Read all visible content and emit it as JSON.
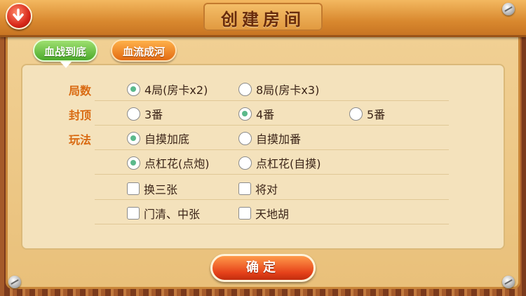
{
  "header": {
    "title": "创建房间"
  },
  "tabs": [
    {
      "label": "血战到底",
      "selected": true
    },
    {
      "label": "血流成河",
      "selected": false
    }
  ],
  "rules": {
    "rounds": {
      "label": "局数",
      "options": [
        {
          "label": "4局(房卡x2)",
          "selected": true
        },
        {
          "label": "8局(房卡x3)",
          "selected": false
        }
      ]
    },
    "cap": {
      "label": "封顶",
      "options": [
        {
          "label": "3番",
          "selected": false
        },
        {
          "label": "4番",
          "selected": true
        },
        {
          "label": "5番",
          "selected": false
        }
      ]
    },
    "play": {
      "label": "玩法",
      "bonus": [
        {
          "label": "自摸加底",
          "selected": true
        },
        {
          "label": "自摸加番",
          "selected": false
        }
      ],
      "kong": [
        {
          "label": "点杠花(点炮)",
          "selected": true
        },
        {
          "label": "点杠花(自摸)",
          "selected": false
        }
      ],
      "extras": [
        {
          "label": "换三张",
          "checked": false
        },
        {
          "label": "将对",
          "checked": false
        },
        {
          "label": "门清、中张",
          "checked": false
        },
        {
          "label": "天地胡",
          "checked": false
        }
      ]
    }
  },
  "confirm_label": "确定",
  "icons": {
    "back": "back-arrow-icon"
  },
  "colors": {
    "accent_green": "#5bb98b",
    "label_orange": "#d96a12",
    "button_red": "#e6421a"
  }
}
